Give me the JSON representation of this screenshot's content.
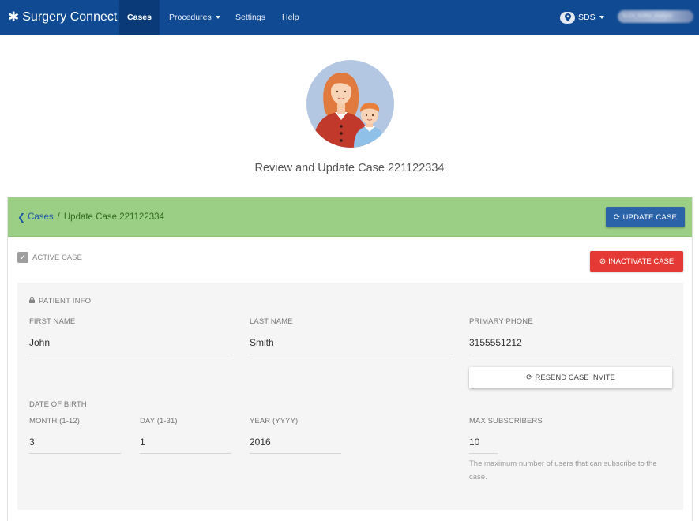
{
  "nav": {
    "brand": "Surgery Connect",
    "items": [
      {
        "label": "Cases"
      },
      {
        "label": "Procedures"
      },
      {
        "label": "Settings"
      },
      {
        "label": "Help"
      }
    ],
    "location": "SDS",
    "user": "SLCH_SURG_sherry02"
  },
  "page": {
    "title": "Review and Update Case 221122334"
  },
  "panel": {
    "breadcrumb_root": "Cases",
    "breadcrumb_sep": "/",
    "breadcrumb_current": "Update Case 221122334",
    "update_button": "UPDATE CASE",
    "active_label": "ACTIVE CASE",
    "active_checked": true,
    "inactivate_button": "INACTIVATE CASE"
  },
  "patient": {
    "section_title": "PATIENT INFO",
    "first_name_label": "FIRST NAME",
    "first_name": "John",
    "last_name_label": "LAST NAME",
    "last_name": "Smith",
    "phone_label": "PRIMARY PHONE",
    "phone": "3155551212",
    "resend_button": "RESEND CASE INVITE",
    "dob_label": "DATE OF BIRTH",
    "month_label": "MONTH (1-12)",
    "month": "3",
    "day_label": "DAY (1-31)",
    "day": "1",
    "year_label": "YEAR (YYYY)",
    "year": "2016",
    "max_label": "MAX SUBSCRIBERS",
    "max": "10",
    "max_help": "The maximum number of users that can subscribe to the case."
  },
  "colors": {
    "navbar": "#0f4a92",
    "header_green": "#9ccf86",
    "update_blue": "#2a63a8",
    "inactivate_red": "#e53935"
  },
  "icons": [
    "asterisk-icon",
    "caret-down-icon",
    "map-pin-icon",
    "chevron-left-icon",
    "refresh-icon",
    "ban-icon",
    "check-icon",
    "lock-icon"
  ]
}
